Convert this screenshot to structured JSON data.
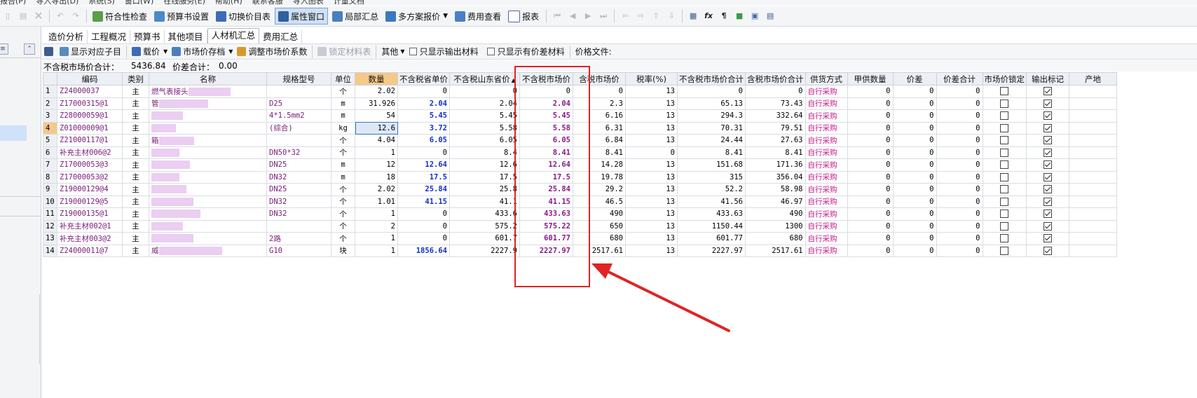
{
  "menu": {
    "items": [
      "报告(P)",
      "导入导出(D)",
      "系统(S)",
      "窗口(W)",
      "在线服务(E)",
      "帮助(H)",
      "联系客服",
      "导入图表",
      "计量文档"
    ]
  },
  "toolbar1": {
    "compliance_check": "符合性检查",
    "budget_settings": "预算书设置",
    "switch_price_list": "切换价目表",
    "property_window": "属性窗口",
    "partial_summary": "局部汇总",
    "multi_plan_quote": "多方案报价",
    "fee_view": "费用查看",
    "report": "报表"
  },
  "tabs": [
    "造价分析",
    "工程概况",
    "预算书",
    "其他项目",
    "人材机汇总",
    "费用汇总"
  ],
  "active_tab_index": 4,
  "toolbar2": {
    "show_sub_items": "显示对应子目",
    "load_price": "载价",
    "market_price_archive": "市场价存档",
    "adjust_coefficient": "调整市场价系数",
    "lock_material_table": "锁定材料表",
    "other": "其他",
    "only_output_materials": "只显示输出材料",
    "only_price_diff": "只显示有价差材料",
    "price_file": "价格文件:"
  },
  "summary": {
    "market_total_label": "不含税市场价合计：",
    "market_total_value": "5436.84",
    "diff_total_label": "价差合计：",
    "diff_total_value": "0.00"
  },
  "columns": [
    "编码",
    "类别",
    "名称",
    "规格型号",
    "单位",
    "数量",
    "不含税省单价",
    "不含税山东省价",
    "不含税市场价",
    "含税市场价",
    "税率(%)",
    "不含税市场价合计",
    "含税市场价合计",
    "供货方式",
    "甲供数量",
    "价差",
    "价差合计",
    "市场价锁定",
    "输出标记",
    "产地"
  ],
  "rows": [
    {
      "no": "1",
      "code": "Z24000037",
      "cat": "主",
      "name": "燃气表接头",
      "spec": "",
      "unit": "个",
      "qty": "2.02",
      "prov_unit": "0",
      "sd_price": "0",
      "market": "0",
      "market_tax": "0",
      "rate": "13",
      "mkt_total": "0",
      "mkt_tax_total": "0",
      "supply": "自行采购",
      "jia": "0",
      "diff": "0",
      "diff_total": "0",
      "lock": false,
      "out": true
    },
    {
      "no": "2",
      "code": "Z17000315@1",
      "cat": "主",
      "name": "管",
      "spec": "D25",
      "unit": "m",
      "qty": "31.926",
      "prov_unit": "2.04",
      "sd_price": "2.04",
      "market": "2.04",
      "market_tax": "2.3",
      "rate": "13",
      "mkt_total": "65.13",
      "mkt_tax_total": "73.43",
      "supply": "自行采购",
      "jia": "0",
      "diff": "0",
      "diff_total": "0",
      "lock": false,
      "out": true
    },
    {
      "no": "3",
      "code": "Z28000059@1",
      "cat": "主",
      "name": "",
      "spec": "4*1.5mm2",
      "unit": "m",
      "qty": "54",
      "prov_unit": "5.45",
      "sd_price": "5.45",
      "market": "5.45",
      "market_tax": "6.16",
      "rate": "13",
      "mkt_total": "294.3",
      "mkt_tax_total": "332.64",
      "supply": "自行采购",
      "jia": "0",
      "diff": "0",
      "diff_total": "0",
      "lock": false,
      "out": true
    },
    {
      "no": "4",
      "code": "Z01000009@1",
      "cat": "主",
      "name": "",
      "spec": "(综合)",
      "unit": "kg",
      "qty": "12.6",
      "prov_unit": "3.72",
      "sd_price": "5.58",
      "market": "5.58",
      "market_tax": "6.31",
      "rate": "13",
      "mkt_total": "70.31",
      "mkt_tax_total": "79.51",
      "supply": "自行采购",
      "jia": "0",
      "diff": "0",
      "diff_total": "0",
      "lock": false,
      "out": true
    },
    {
      "no": "5",
      "code": "Z21000117@1",
      "cat": "主",
      "name": "箱",
      "spec": "",
      "unit": "个",
      "qty": "4.04",
      "prov_unit": "6.05",
      "sd_price": "6.05",
      "market": "6.05",
      "market_tax": "6.84",
      "rate": "13",
      "mkt_total": "24.44",
      "mkt_tax_total": "27.63",
      "supply": "自行采购",
      "jia": "0",
      "diff": "0",
      "diff_total": "0",
      "lock": false,
      "out": true
    },
    {
      "no": "6",
      "code": "补充主材006@2",
      "cat": "主",
      "name": "",
      "spec": "DN50*32",
      "unit": "个",
      "qty": "1",
      "prov_unit": "0",
      "sd_price": "8.4",
      "market": "8.41",
      "market_tax": "8.41",
      "rate": "0",
      "mkt_total": "8.41",
      "mkt_tax_total": "8.41",
      "supply": "自行采购",
      "jia": "0",
      "diff": "0",
      "diff_total": "0",
      "lock": false,
      "out": true
    },
    {
      "no": "7",
      "code": "Z17000053@3",
      "cat": "主",
      "name": "",
      "spec": "DN25",
      "unit": "m",
      "qty": "12",
      "prov_unit": "12.64",
      "sd_price": "12.6",
      "market": "12.64",
      "market_tax": "14.28",
      "rate": "13",
      "mkt_total": "151.68",
      "mkt_tax_total": "171.36",
      "supply": "自行采购",
      "jia": "0",
      "diff": "0",
      "diff_total": "0",
      "lock": false,
      "out": true
    },
    {
      "no": "8",
      "code": "Z17000053@2",
      "cat": "主",
      "name": "",
      "spec": "DN32",
      "unit": "m",
      "qty": "18",
      "prov_unit": "17.5",
      "sd_price": "17.5",
      "market": "17.5",
      "market_tax": "19.78",
      "rate": "13",
      "mkt_total": "315",
      "mkt_tax_total": "356.04",
      "supply": "自行采购",
      "jia": "0",
      "diff": "0",
      "diff_total": "0",
      "lock": false,
      "out": true
    },
    {
      "no": "9",
      "code": "Z19000129@4",
      "cat": "主",
      "name": "",
      "spec": "DN25",
      "unit": "个",
      "qty": "2.02",
      "prov_unit": "25.84",
      "sd_price": "25.8",
      "market": "25.84",
      "market_tax": "29.2",
      "rate": "13",
      "mkt_total": "52.2",
      "mkt_tax_total": "58.98",
      "supply": "自行采购",
      "jia": "0",
      "diff": "0",
      "diff_total": "0",
      "lock": false,
      "out": true
    },
    {
      "no": "10",
      "code": "Z19000129@5",
      "cat": "主",
      "name": "",
      "spec": "DN32",
      "unit": "个",
      "qty": "1.01",
      "prov_unit": "41.15",
      "sd_price": "41.1",
      "market": "41.15",
      "market_tax": "46.5",
      "rate": "13",
      "mkt_total": "41.56",
      "mkt_tax_total": "46.97",
      "supply": "自行采购",
      "jia": "0",
      "diff": "0",
      "diff_total": "0",
      "lock": false,
      "out": true
    },
    {
      "no": "11",
      "code": "Z19000135@1",
      "cat": "主",
      "name": "",
      "spec": "DN32",
      "unit": "个",
      "qty": "1",
      "prov_unit": "0",
      "sd_price": "433.6",
      "market": "433.63",
      "market_tax": "490",
      "rate": "13",
      "mkt_total": "433.63",
      "mkt_tax_total": "490",
      "supply": "自行采购",
      "jia": "0",
      "diff": "0",
      "diff_total": "0",
      "lock": false,
      "out": true
    },
    {
      "no": "12",
      "code": "补充主材002@1",
      "cat": "主",
      "name": "",
      "spec": "",
      "unit": "个",
      "qty": "2",
      "prov_unit": "0",
      "sd_price": "575.2",
      "market": "575.22",
      "market_tax": "650",
      "rate": "13",
      "mkt_total": "1150.44",
      "mkt_tax_total": "1300",
      "supply": "自行采购",
      "jia": "0",
      "diff": "0",
      "diff_total": "0",
      "lock": false,
      "out": true
    },
    {
      "no": "13",
      "code": "补充主材003@2",
      "cat": "主",
      "name": "",
      "spec": "2路",
      "unit": "个",
      "qty": "1",
      "prov_unit": "0",
      "sd_price": "601.7",
      "market": "601.77",
      "market_tax": "680",
      "rate": "13",
      "mkt_total": "601.77",
      "mkt_tax_total": "680",
      "supply": "自行采购",
      "jia": "0",
      "diff": "0",
      "diff_total": "0",
      "lock": false,
      "out": true
    },
    {
      "no": "14",
      "code": "Z24000011@7",
      "cat": "主",
      "name": "威",
      "spec": "G10",
      "unit": "块",
      "qty": "1",
      "prov_unit": "1856.64",
      "sd_price": "2227.9",
      "market": "2227.97",
      "market_tax": "2517.61",
      "rate": "13",
      "mkt_total": "2227.97",
      "mkt_tax_total": "2517.61",
      "supply": "自行采购",
      "jia": "0",
      "diff": "0",
      "diff_total": "0",
      "lock": false,
      "out": true
    }
  ],
  "selected_row": 4,
  "colors": {
    "highlight_header": "#f5c98a",
    "annotation_red": "#e02424",
    "code_purple": "#7a1a7a",
    "value_blue": "#1230c8",
    "supply_magenta": "#c01888"
  }
}
